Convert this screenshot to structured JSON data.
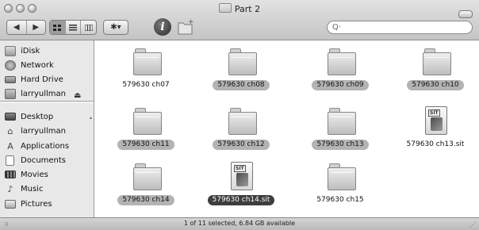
{
  "window": {
    "title": "Part 2"
  },
  "toolbar": {
    "back_forward": [
      "◀",
      "▶"
    ],
    "view_modes": [
      "icon-view",
      "list-view",
      "column-view"
    ],
    "action_label": "✱▾",
    "search_placeholder": "Q·"
  },
  "sidebar": {
    "devices": [
      {
        "label": "iDisk",
        "icon": "idisk-icon"
      },
      {
        "label": "Network",
        "icon": "network-icon"
      },
      {
        "label": "Hard Drive",
        "icon": "hard-drive-icon"
      },
      {
        "label": "larryullman",
        "icon": "user-drive-icon"
      }
    ],
    "places": [
      {
        "label": "Desktop",
        "icon": "desktop-icon"
      },
      {
        "label": "larryullman",
        "icon": "home-icon"
      },
      {
        "label": "Applications",
        "icon": "applications-icon"
      },
      {
        "label": "Documents",
        "icon": "documents-icon"
      },
      {
        "label": "Movies",
        "icon": "movies-icon"
      },
      {
        "label": "Music",
        "icon": "music-icon"
      },
      {
        "label": "Pictures",
        "icon": "pictures-icon"
      }
    ]
  },
  "files": [
    {
      "name": "579630 ch07",
      "kind": "folder",
      "label_style": "none"
    },
    {
      "name": "579630 ch08",
      "kind": "folder",
      "label_style": "grey"
    },
    {
      "name": "579630 ch09",
      "kind": "folder",
      "label_style": "grey"
    },
    {
      "name": "579630 ch10",
      "kind": "folder",
      "label_style": "grey"
    },
    {
      "name": "579630 ch11",
      "kind": "folder",
      "label_style": "grey"
    },
    {
      "name": "579630 ch12",
      "kind": "folder",
      "label_style": "grey"
    },
    {
      "name": "579630 ch13",
      "kind": "folder",
      "label_style": "grey"
    },
    {
      "name": "579630 ch13.sit",
      "kind": "sit-archive",
      "label_style": "none"
    },
    {
      "name": "579630 ch14",
      "kind": "folder",
      "label_style": "grey"
    },
    {
      "name": "579630 ch14.sit",
      "kind": "sit-archive",
      "label_style": "selected"
    },
    {
      "name": "579630 ch15",
      "kind": "folder",
      "label_style": "none"
    }
  ],
  "status": {
    "text": "1 of 11 selected, 6.84 GB available"
  },
  "colors": {
    "selection": "#3d3d3d",
    "label_grey": "#b3b3b3",
    "sidebar_bg": "#e8e8e8"
  }
}
